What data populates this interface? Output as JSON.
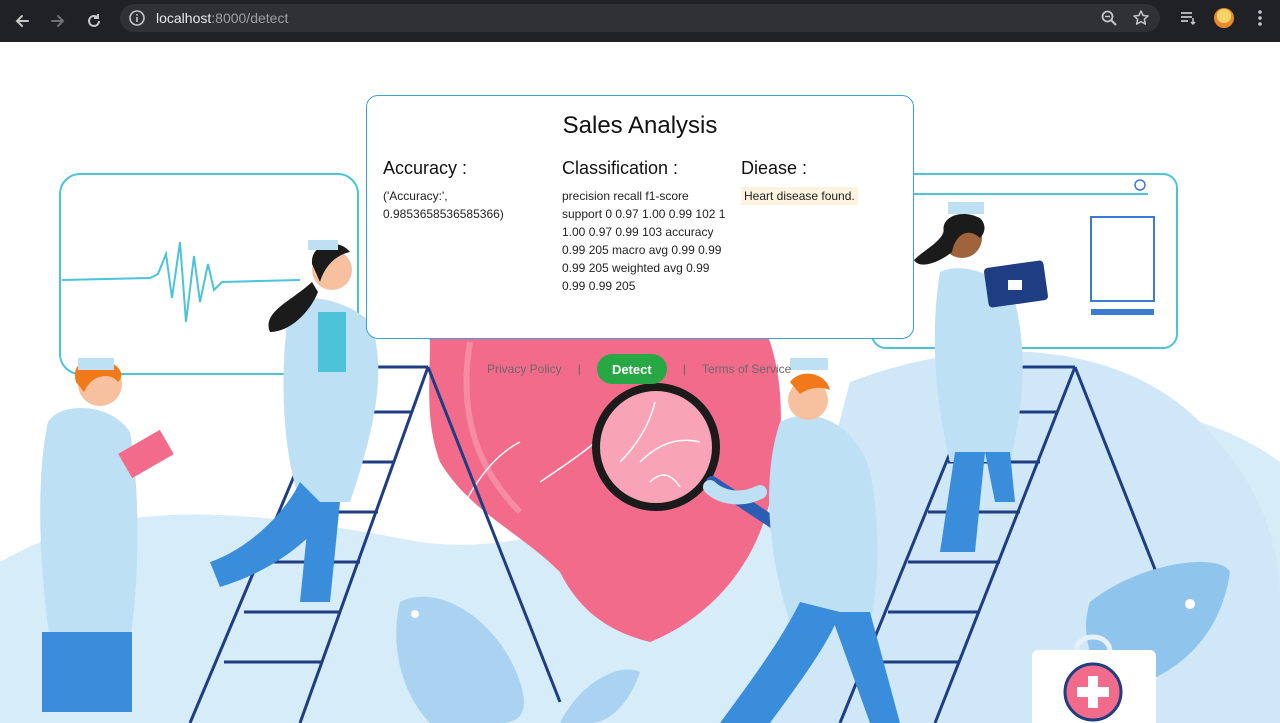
{
  "browser": {
    "url_host": "localhost",
    "url_rest": ":8000/detect",
    "icons": [
      "back-arrow-icon",
      "forward-arrow-icon",
      "reload-icon",
      "site-info-icon",
      "zoom-icon",
      "star-icon",
      "reading-list-icon",
      "profile-avatar",
      "menu-kebab-icon"
    ]
  },
  "card": {
    "title": "Sales Analysis",
    "accuracy": {
      "heading": "Accuracy :",
      "value": "('Accuracy:', 0.9853658536585366)"
    },
    "classification": {
      "heading": "Classification :",
      "value": "precision recall f1-score support 0 0.97 1.00 0.99 102 1 1.00 0.97 0.99 103 accuracy 0.99 205 macro avg 0.99 0.99 0.99 205 weighted avg 0.99 0.99 0.99 205"
    },
    "disease": {
      "heading": "Diease :",
      "value": "Heart disease found."
    }
  },
  "footer": {
    "privacy": "Privacy Policy",
    "separator": "|",
    "detect": "Detect",
    "terms": "Terms of Service"
  },
  "colors": {
    "accent_green": "#28a745",
    "card_border": "#3aa0d8",
    "heart": "#f26b8a",
    "background_blob": "#d6ecf8"
  }
}
